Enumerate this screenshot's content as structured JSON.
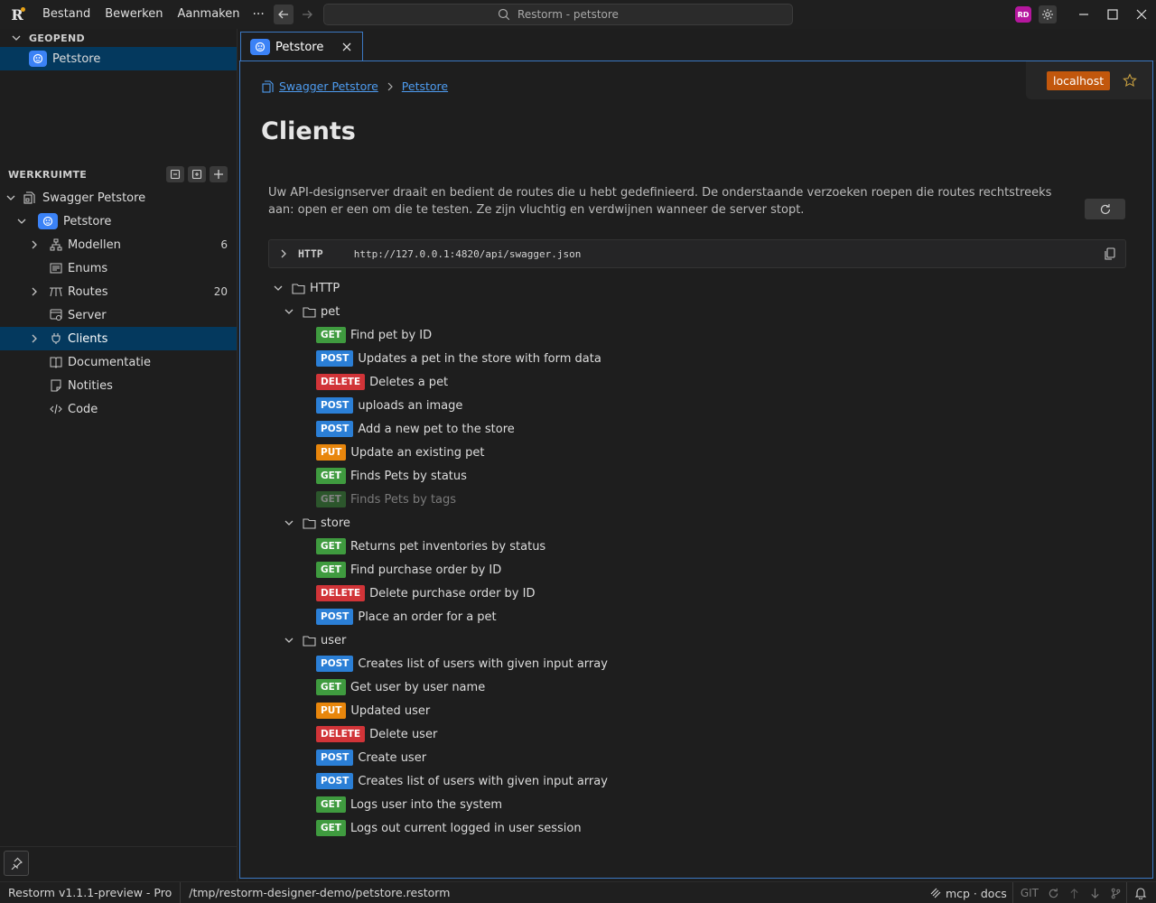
{
  "titlebar": {
    "menu": [
      "Bestand",
      "Bewerken",
      "Aanmaken"
    ],
    "more": "···",
    "search": "Restorm - petstore",
    "avatar": "RD"
  },
  "sidebar": {
    "open_section": "GEOPEND",
    "open_item": "Petstore",
    "workspace_section": "WERKRUIMTE",
    "workspace_root": "Swagger Petstore",
    "project": "Petstore",
    "items": [
      {
        "label": "Modellen",
        "count": "6",
        "icon": "models-icon"
      },
      {
        "label": "Enums",
        "count": "",
        "icon": "enums-icon"
      },
      {
        "label": "Routes",
        "count": "20",
        "icon": "routes-icon"
      },
      {
        "label": "Server",
        "count": "",
        "icon": "server-icon"
      },
      {
        "label": "Clients",
        "count": "",
        "icon": "plug-icon"
      },
      {
        "label": "Documentatie",
        "count": "",
        "icon": "book-icon"
      },
      {
        "label": "Notities",
        "count": "",
        "icon": "note-icon"
      },
      {
        "label": "Code",
        "count": "",
        "icon": "code-icon"
      }
    ]
  },
  "tab": {
    "label": "Petstore"
  },
  "main": {
    "breadcrumb": [
      "Swagger Petstore",
      "Petstore"
    ],
    "title": "Clients",
    "server": "localhost",
    "description": "Uw API-designserver draait en bedient de routes die u hebt gedefinieerd. De onderstaande verzoeken roepen die routes rechtstreeks aan: open er een om die te testen. Ze zijn vluchtig en verdwijnen wanneer de server stopt.",
    "url_proto": "HTTP",
    "url": "http://127.0.0.1:4820/api/swagger.json",
    "root_folder": "HTTP",
    "groups": [
      {
        "name": "pet",
        "routes": [
          {
            "method": "GET",
            "label": "Find pet by ID"
          },
          {
            "method": "POST",
            "label": "Updates a pet in the store with form data"
          },
          {
            "method": "DELETE",
            "label": "Deletes a pet"
          },
          {
            "method": "POST",
            "label": "uploads an image"
          },
          {
            "method": "POST",
            "label": "Add a new pet to the store"
          },
          {
            "method": "PUT",
            "label": "Update an existing pet"
          },
          {
            "method": "GET",
            "label": "Finds Pets by status"
          },
          {
            "method": "GET",
            "label": "Finds Pets by tags",
            "disabled": true
          }
        ]
      },
      {
        "name": "store",
        "routes": [
          {
            "method": "GET",
            "label": "Returns pet inventories by status"
          },
          {
            "method": "GET",
            "label": "Find purchase order by ID"
          },
          {
            "method": "DELETE",
            "label": "Delete purchase order by ID"
          },
          {
            "method": "POST",
            "label": "Place an order for a pet"
          }
        ]
      },
      {
        "name": "user",
        "routes": [
          {
            "method": "POST",
            "label": "Creates list of users with given input array"
          },
          {
            "method": "GET",
            "label": "Get user by user name"
          },
          {
            "method": "PUT",
            "label": "Updated user"
          },
          {
            "method": "DELETE",
            "label": "Delete user"
          },
          {
            "method": "POST",
            "label": "Create user"
          },
          {
            "method": "POST",
            "label": "Creates list of users with given input array"
          },
          {
            "method": "GET",
            "label": "Logs user into the system"
          },
          {
            "method": "GET",
            "label": "Logs out current logged in user session"
          }
        ]
      }
    ]
  },
  "method_colors": {
    "GET": "#3f9b3f",
    "POST": "#2b7fd6",
    "DELETE": "#d13438",
    "PUT": "#e8860c"
  },
  "statusbar": {
    "version": "Restorm v1.1.1-preview - Pro",
    "path": "/tmp/restorm-designer-demo/petstore.restorm",
    "mcp": "mcp · docs",
    "git": "GIT"
  }
}
